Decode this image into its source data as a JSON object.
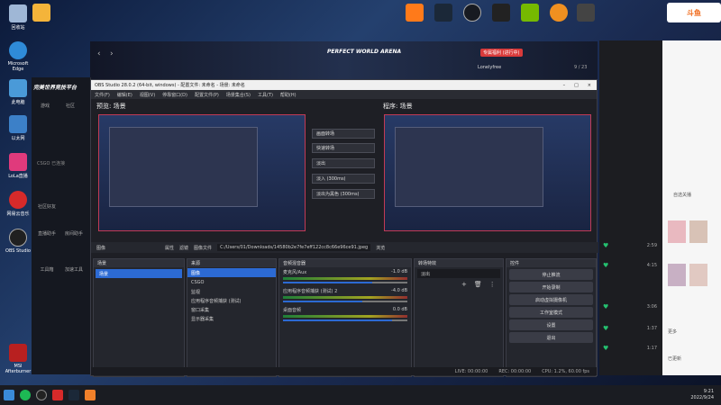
{
  "desktop_icons": [
    {
      "label": "回收站",
      "color": "#9fb7d6"
    },
    {
      "label": "Microsoft Edge",
      "color": "#2f8bd8"
    },
    {
      "label": "此电脑",
      "color": "#4a9ad8"
    },
    {
      "label": "以太网",
      "color": "#3c80c8"
    },
    {
      "label": "LoLa直播",
      "color": "#e03a7c"
    },
    {
      "label": "网易云音乐",
      "color": "#d72a2a"
    },
    {
      "label": "OBS Studio",
      "color": "#202020"
    },
    {
      "label": "MSI Afterburner",
      "color": "#b82020"
    }
  ],
  "top_icons": [
    "YY",
    "WeGame",
    "SLAM",
    "Steam",
    "Epic Games",
    "NVIDIA",
    "Edge"
  ],
  "douyu_label": "斗鱼",
  "game_header": {
    "title": "PERFECT WORLD ARENA",
    "user": "Lonelyfree",
    "badge": "专属福利 (进行中)",
    "count": "9 / 23"
  },
  "client": {
    "logo": "完美世界竞技平台",
    "tabs": [
      "游戏",
      "社区"
    ],
    "items": [
      "直播助手",
      "房间助手",
      "工具箱",
      "加速工具",
      "社区好友"
    ],
    "status": "CSGO 已连接"
  },
  "obs": {
    "title": "OBS Studio 28.0.2 (64-bit, windows) - 配置文件: 未命名 - 场景: 未命名",
    "menu": [
      "文件(F)",
      "编辑(E)",
      "视图(V)",
      "停靠窗口(D)",
      "配置文件(P)",
      "场景集合(S)",
      "工具(T)",
      "帮助(H)"
    ],
    "preview_label": "预览: 场景",
    "program_label": "程序: 场景",
    "transition_buttons": [
      "画面转场",
      "快速转场",
      "淡出",
      "淡入 (300ms)",
      "淡出为黑色 (300ms)"
    ],
    "transition_selected": "画面转场",
    "source_toolbar": {
      "name": "图像",
      "properties": "属性",
      "filter": "滤镜",
      "file_label": "图像文件",
      "path": "C:/Users/01/Downloads/14580b2e7fe7eff122cc8c66e96ce91.jpeg",
      "browse": "浏览"
    },
    "scenes": {
      "title": "场景",
      "items": [
        "场景"
      ]
    },
    "sources": {
      "title": "来源",
      "items": [
        "图像",
        "CSGO",
        "监视",
        "应用程序音频捕获 (测试)",
        "窗口采集",
        "显示器采集"
      ]
    },
    "mixer": {
      "title": "音频混音器",
      "channels": [
        {
          "name": "麦克风/Aux",
          "db": "-1.0 dB",
          "level": 0.72
        },
        {
          "name": "应用程序音频捕获 (测试) 2",
          "db": "-4.0 dB",
          "level": 0.64
        },
        {
          "name": "桌面音频",
          "db": "0.0 dB",
          "level": 0.88
        }
      ]
    },
    "transitions": {
      "title": "转场特效",
      "selected": "淡出"
    },
    "controls": {
      "title": "控件",
      "buttons": [
        "停止推流",
        "开始录制",
        "启动虚拟摄像机",
        "工作室模式",
        "设置",
        "退出"
      ]
    },
    "status": {
      "live": "LIVE: 00:00:00",
      "rec": "REC: 00:00:00",
      "cpu": "CPU: 1.2%, 60.00 fps"
    }
  },
  "chat": {
    "rows": [
      {
        "count": "2:59"
      },
      {
        "count": "4:15"
      },
      {
        "count": "3:06"
      },
      {
        "count": "1:37"
      },
      {
        "count": "1:17"
      }
    ]
  },
  "right_panel": {
    "heading": "自选关播",
    "items": [
      "更多",
      "已更新"
    ]
  },
  "taskbar": {
    "time": "9:21",
    "date": "2022/9/24"
  },
  "colors": {
    "accent": "#2c6ad3",
    "recording_border": "#c23a55",
    "obs_bg": "#1e1f25"
  }
}
